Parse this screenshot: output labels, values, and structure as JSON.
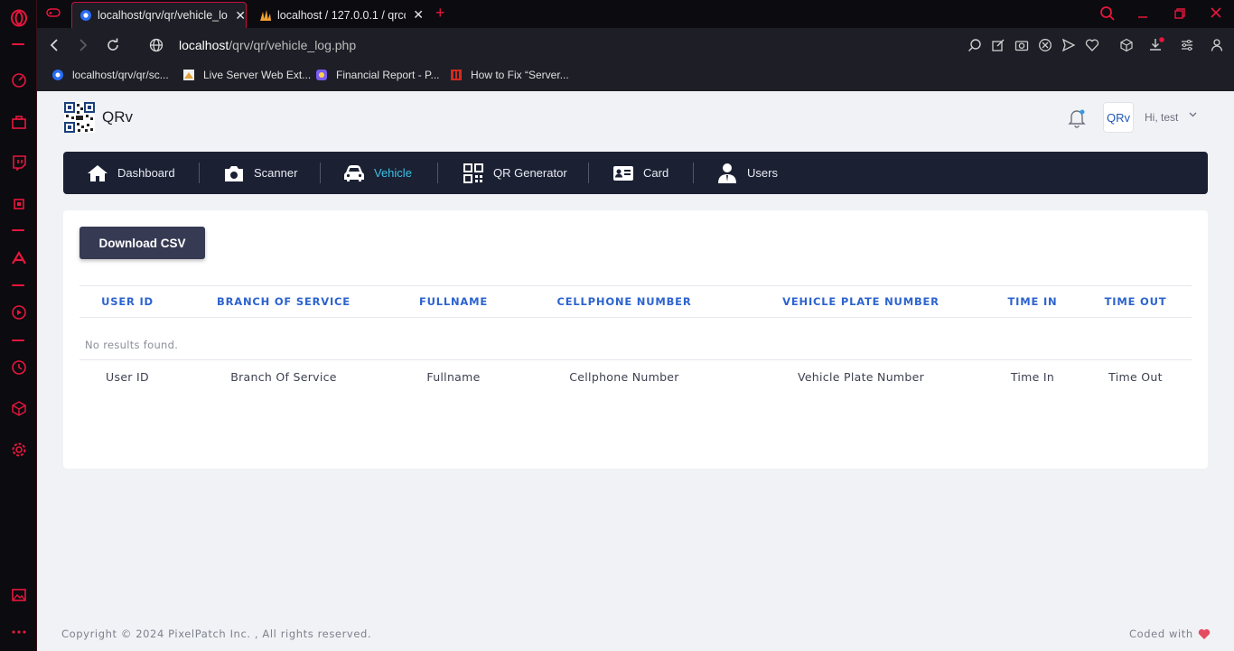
{
  "browser": {
    "tabs": [
      {
        "title": "localhost/qrv/qr/vehicle_lo",
        "active": true
      },
      {
        "title": "localhost / 127.0.0.1 / qrco",
        "active": false
      }
    ],
    "new_tab_label": "+",
    "address": {
      "host": "localhost",
      "path": "/qrv/qr/vehicle_log.php"
    },
    "bookmarks": [
      {
        "label": "localhost/qrv/qr/sc...",
        "color": "#2a6df4"
      },
      {
        "label": "Live Server Web Ext...",
        "color": "#e2a23a"
      },
      {
        "label": "Financial Report - P...",
        "color": "#7b5cf0"
      },
      {
        "label": "How to Fix “Server...",
        "color": "#d42a1f"
      }
    ],
    "accent": "#e8163c"
  },
  "app": {
    "brand": "QRv",
    "avatar_text": "QRv",
    "greeting": "Hi, test",
    "nav": [
      {
        "label": "Dashboard",
        "icon": "home-icon",
        "active": false
      },
      {
        "label": "Scanner",
        "icon": "camera-icon",
        "active": false
      },
      {
        "label": "Vehicle",
        "icon": "car-icon",
        "active": true
      },
      {
        "label": "QR Generator",
        "icon": "qr-code-icon",
        "active": false
      },
      {
        "label": "Card",
        "icon": "id-card-icon",
        "active": false
      },
      {
        "label": "Users",
        "icon": "user-icon",
        "active": false
      }
    ],
    "nav_active_color": "#3bc2e6",
    "download_label": "Download CSV",
    "table": {
      "headers": [
        "USER ID",
        "BRANCH OF SERVICE",
        "FULLNAME",
        "CELLPHONE NUMBER",
        "VEHICLE PLATE NUMBER",
        "TIME IN",
        "TIME OUT"
      ],
      "empty_message": "No results found.",
      "footers": [
        "User ID",
        "Branch Of Service",
        "Fullname",
        "Cellphone Number",
        "Vehicle Plate Number",
        "Time In",
        "Time Out"
      ]
    },
    "footer": {
      "copyright": "Copyright © 2024 PixelPatch Inc. , All rights reserved.",
      "coded_with": "Coded with"
    }
  }
}
